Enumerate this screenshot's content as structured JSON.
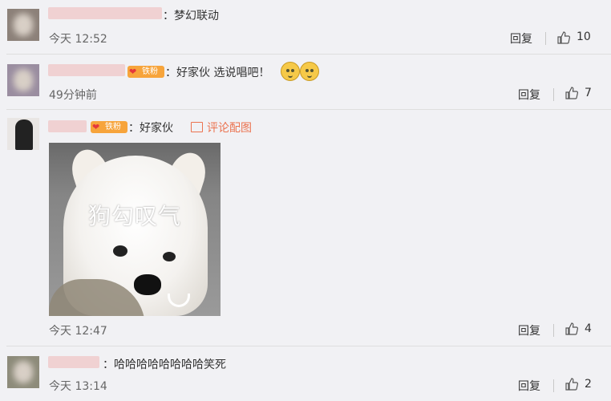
{
  "comments": [
    {
      "text": "：梦幻联动",
      "time": "今天 12:52",
      "reply": "回复",
      "likes": "10"
    },
    {
      "badge": "铁粉",
      "text": "：好家伙 选说唱吧！",
      "emojis": [
        "doge-icon",
        "doge-icon"
      ],
      "time": "49分钟前",
      "reply": "回复",
      "likes": "7"
    },
    {
      "badge": "铁粉",
      "text": "：好家伙",
      "pic_link": "评论配图",
      "photo_caption": "狗勾叹气",
      "time": "今天 12:47",
      "reply": "回复",
      "likes": "4"
    },
    {
      "text": "：哈哈哈哈哈哈哈哈笑死",
      "time": "今天 13:14",
      "reply": "回复",
      "likes": "2"
    }
  ],
  "colors": {
    "background": "#f1f1f4",
    "accent_link": "#eb7350",
    "badge": "#f7a43b"
  }
}
